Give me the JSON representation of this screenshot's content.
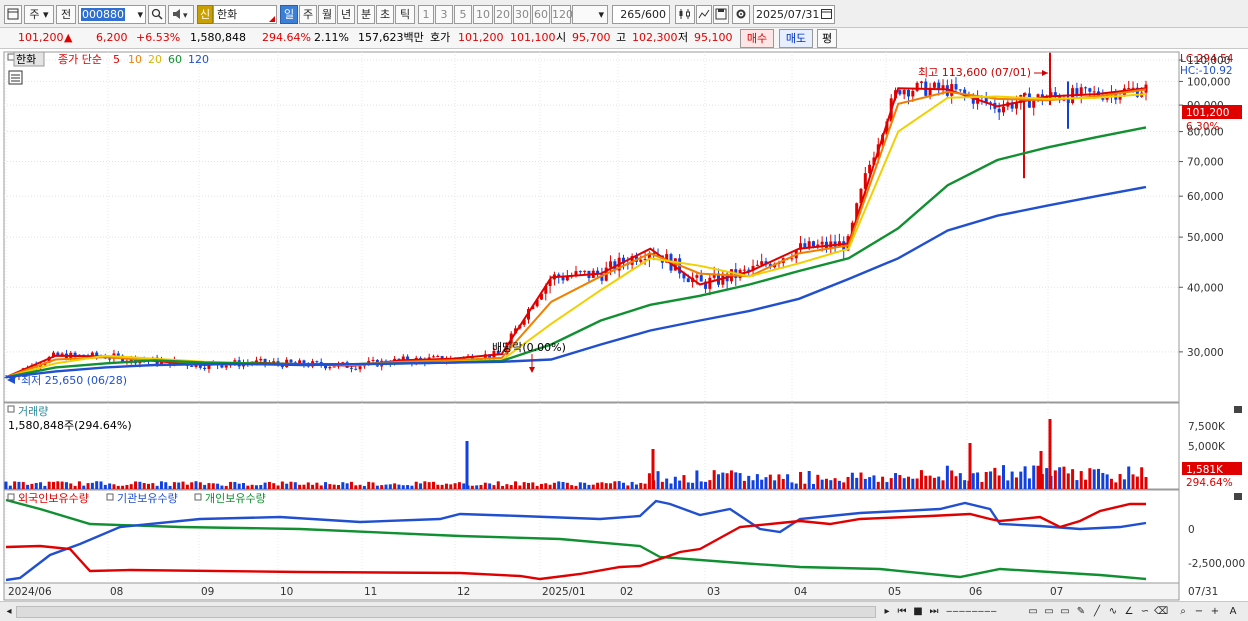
{
  "toolbar": {
    "period_mode": "주",
    "prev_label": "전",
    "stock_code": "000880",
    "search_icon": "magnifier-icon",
    "sound_icon": "speaker-icon",
    "badge": "신",
    "stock_name": "한화",
    "periods": [
      "일",
      "주",
      "월",
      "년",
      "분",
      "초",
      "틱"
    ],
    "active_period": "일",
    "intervals": [
      "1",
      "3",
      "5",
      "10",
      "20",
      "30",
      "60",
      "120"
    ],
    "count_value": "265",
    "count_total": "/600",
    "date": "2025/07/31"
  },
  "quote": {
    "price": "101,200",
    "change": "6,200",
    "change_pct": "+6.53%",
    "volume": "1,580,848",
    "volume_ratio": "294.64%",
    "turnover": "2.11%",
    "amount": "157,623백만",
    "bid_label": "호가",
    "bid1": "101,200",
    "bid2": "101,100",
    "open_label": "시",
    "open": "95,700",
    "high_label": "고",
    "high": "102,300",
    "low_label": "저",
    "low": "95,100",
    "buy_label": "매수",
    "sell_label": "매도",
    "eval_label": "평"
  },
  "price_panel": {
    "name_tag": "한화",
    "legend_label": "종가 단순",
    "ma_periods": [
      "5",
      "10",
      "20",
      "60",
      "120"
    ],
    "ma_colors": [
      "#e00000",
      "#f08000",
      "#f0d000",
      "#109030",
      "#2050d0"
    ],
    "lc": "LC:294.54",
    "hc": "HC:-10.92",
    "price_tag": "101,200",
    "price_tag_pct": "6.30%",
    "y_labels": [
      "110,000",
      "100,000",
      "90,000",
      "80,000",
      "70,000",
      "60,000",
      "50,000",
      "40,000",
      "30,000"
    ],
    "max_annotation": "최고 113,600 (07/01)",
    "min_annotation": "최저 25,650 (06/28)",
    "dividend_annotation": "배당락(0.00%)"
  },
  "volume_panel": {
    "title": "거래량",
    "subtitle": "1,580,848주(294.64%)",
    "y_labels": [
      "7,500K",
      "5,000K"
    ],
    "tag": "1,581K",
    "tag_pct": "294.64%"
  },
  "holding_panel": {
    "legend": [
      "외국인보유수량",
      "기관보유수량",
      "개인보유수량"
    ],
    "legend_colors": [
      "#e00000",
      "#2050d0",
      "#109030"
    ],
    "y_labels": [
      "0",
      "-2,500,000"
    ]
  },
  "x_axis": {
    "labels": [
      "2024/06",
      "08",
      "09",
      "10",
      "11",
      "12",
      "2025/01",
      "02",
      "03",
      "04",
      "05",
      "06",
      "07"
    ],
    "end_label": "07/31"
  },
  "chart_data": {
    "type": "candlestick",
    "series_ma": [
      {
        "name": "5",
        "values": [
          26.8,
          29.5,
          29.4,
          28.8,
          28.3,
          28.6,
          28.4,
          28.2,
          28.9,
          29.1,
          29.7,
          41.8,
          42.5,
          47.5,
          40.5,
          42.9,
          47.5,
          48.6,
          97.0,
          96.5,
          89.5,
          93.5,
          94.5,
          97.0
        ]
      },
      {
        "name": "10",
        "values": [
          26.8,
          29.0,
          29.3,
          28.9,
          28.5,
          28.4,
          28.3,
          28.4,
          28.7,
          28.9,
          29.2,
          37.5,
          42.0,
          46.5,
          42.5,
          42.0,
          46.5,
          48.2,
          90.5,
          95.5,
          92.5,
          92.0,
          93.5,
          96.5
        ]
      },
      {
        "name": "20",
        "values": [
          26.8,
          28.5,
          29.5,
          29.1,
          28.7,
          28.5,
          28.4,
          28.3,
          28.5,
          28.7,
          28.9,
          34.0,
          39.5,
          45.5,
          44.0,
          42.0,
          44.5,
          47.5,
          80.0,
          93.0,
          93.5,
          92.5,
          93.0,
          94.5
        ]
      },
      {
        "name": "60",
        "values": [
          26.8,
          28.0,
          28.5,
          28.9,
          28.6,
          28.5,
          28.4,
          28.4,
          28.5,
          28.6,
          28.8,
          31.0,
          34.5,
          37.0,
          38.5,
          40.5,
          43.0,
          45.5,
          52.0,
          63.0,
          70.5,
          74.5,
          78.0,
          81.5
        ]
      },
      {
        "name": "120",
        "values": [
          26.8,
          27.5,
          28.0,
          28.3,
          28.4,
          28.4,
          28.3,
          28.4,
          28.5,
          28.6,
          28.7,
          29.0,
          31.0,
          33.0,
          34.5,
          36.0,
          38.0,
          41.5,
          45.5,
          51.5,
          55.0,
          57.5,
          60.0,
          62.5
        ]
      }
    ],
    "y_unit": "thousand KRW",
    "ylim": [
      24,
      114
    ],
    "max_price": 113600,
    "min_price": 25650
  }
}
